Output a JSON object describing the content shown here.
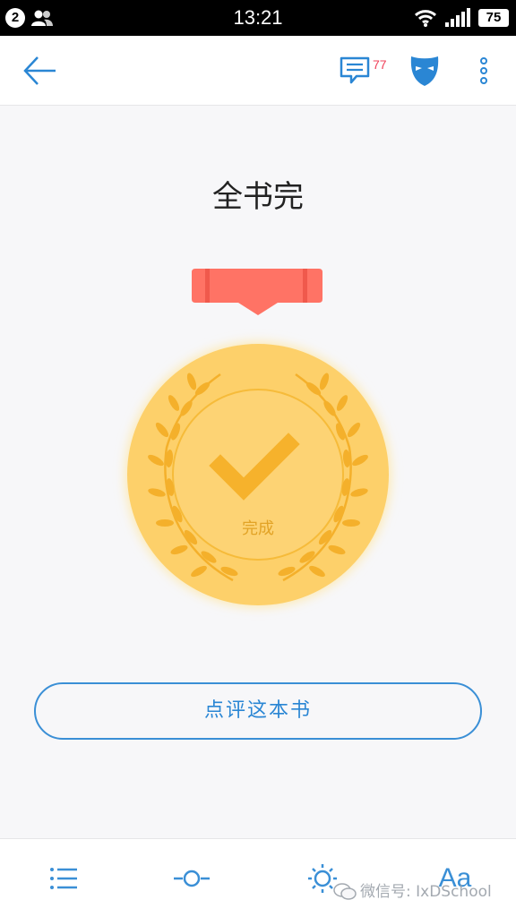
{
  "status_bar": {
    "notification_count": "2",
    "time": "13:21",
    "battery": "75"
  },
  "top_bar": {
    "back_icon": "arrow-left-icon",
    "comment_icon": "comment-icon",
    "comment_count": "77",
    "mask_icon": "mask-icon",
    "more_icon": "more-vertical-icon"
  },
  "main": {
    "title": "全书完",
    "medal_label": "完成",
    "review_button": "点评这本书"
  },
  "bottom_bar": {
    "toc_icon": "list-icon",
    "progress_icon": "progress-slider-icon",
    "brightness_icon": "sun-icon",
    "font_label": "Aa"
  },
  "watermark": {
    "text": "微信号: IxDSchool"
  },
  "colors": {
    "accent": "#2a86d4",
    "ribbon": "#ff7365",
    "medal_gold": "#fdd06a",
    "badge_red": "#f0415a"
  }
}
